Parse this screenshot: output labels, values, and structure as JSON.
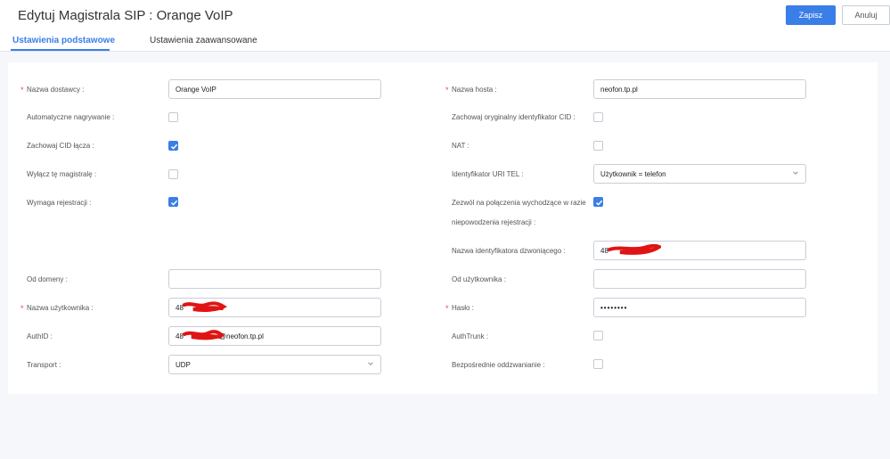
{
  "header": {
    "title": "Edytuj Magistrala SIP : Orange VoIP",
    "save_label": "Zapisz",
    "cancel_label": "Anuluj"
  },
  "tabs": [
    {
      "label": "Ustawienia podstawowe",
      "active": true
    },
    {
      "label": "Ustawienia zaawansowane",
      "active": false
    }
  ],
  "accent_color": "#3a7ee7",
  "required_color": "#e5484d",
  "left": {
    "provider_name": {
      "label": "Nazwa dostawcy :",
      "value": "Orange VoIP",
      "required": true
    },
    "auto_record": {
      "label": "Automatyczne nagrywanie :",
      "checked": false
    },
    "keep_cid": {
      "label": "Zachowaj CID łącza :",
      "checked": true
    },
    "disable_trunk": {
      "label": "Wyłącz tę magistralę :",
      "checked": false
    },
    "require_registration": {
      "label": "Wymaga rejestracji :",
      "checked": true
    },
    "from_domain": {
      "label": "Od domeny :",
      "value": ""
    },
    "username": {
      "label": "Nazwa użytkownika :",
      "value": "48",
      "required": true
    },
    "authid": {
      "label": "AuthID :",
      "value_prefix": "48",
      "value_suffix": "@neofon.tp.pl"
    },
    "transport": {
      "label": "Transport :",
      "value": "UDP"
    }
  },
  "right": {
    "host_name": {
      "label": "Nazwa hosta :",
      "value": "neofon.tp.pl",
      "required": true
    },
    "keep_original_cid": {
      "label": "Zachowaj oryginalny identyfikator CID :",
      "checked": false
    },
    "nat": {
      "label": "NAT :",
      "checked": false
    },
    "tel_uri": {
      "label": "Identyfikator URI TEL :",
      "value": "Użytkownik = telefon"
    },
    "allow_outgoing": {
      "label_line1": "Zezwól na połączenia wychodzące w razie",
      "label_line2": "niepowodzenia rejestracji :",
      "checked": true
    },
    "caller_id_name": {
      "label": "Nazwa identyfikatora dzwoniącego :",
      "value": "48"
    },
    "from_user": {
      "label": "Od użytkownika :",
      "value": ""
    },
    "password": {
      "label": "Hasło :",
      "value": "••••••••",
      "required": true
    },
    "authtrunk": {
      "label": "AuthTrunk :",
      "checked": false
    },
    "direct_media": {
      "label": "Bezpośrednie oddzwanianie :",
      "checked": false
    }
  }
}
